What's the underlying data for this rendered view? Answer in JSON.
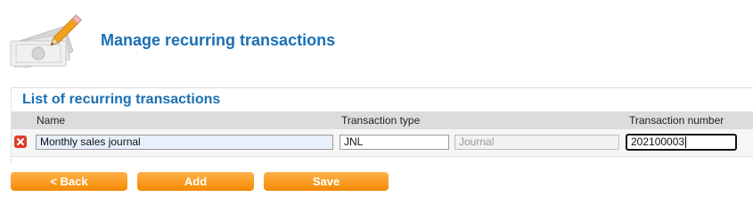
{
  "page": {
    "title": "Manage recurring transactions",
    "icon": "money-pencil-icon"
  },
  "panel": {
    "title": "List of recurring transactions",
    "columns": [
      "Name",
      "Transaction type",
      "Transaction number"
    ],
    "rows": [
      {
        "name": "Monthly sales journal",
        "type_code": "JNL",
        "type_name": "Journal",
        "number": "202100003"
      }
    ]
  },
  "buttons": {
    "back": "< Back",
    "add": "Add",
    "save": "Save"
  },
  "colors": {
    "title": "#1a6fb3",
    "button": "#f48a00",
    "delete": "#e23b2a",
    "header_row": "#dcdcdc"
  }
}
